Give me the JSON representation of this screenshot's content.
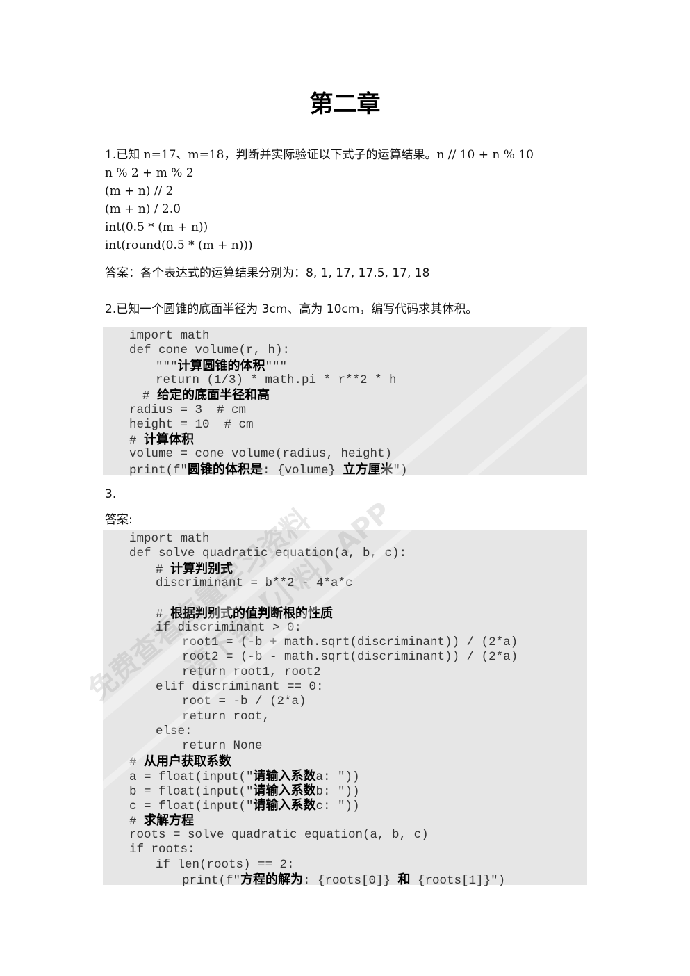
{
  "heading": "第二章",
  "q1": {
    "lines": [
      "1.已知 n=17、m=18，判断并实际验证以下式子的运算结果。n // 10 + n % 10",
      "n % 2 + m % 2",
      "(m + n) // 2",
      "(m + n) / 2.0",
      "int(0.5 * (m + n))",
      "int(round(0.5 * (m + n)))"
    ],
    "answer": "答案：各个表达式的运算结果分别为：8, 1, 17, 17.5, 17, 18"
  },
  "q2": {
    "question": "2.已知一个圆锥的底面半径为 3cm、高为 10cm，编写代码求其体积。",
    "code": [
      {
        "indent": 0,
        "parts": [
          {
            "t": "import math"
          }
        ]
      },
      {
        "indent": 0,
        "parts": [
          {
            "t": "def cone volume(r, h):"
          }
        ]
      },
      {
        "indent": 2,
        "parts": [
          {
            "t": "\"\"\""
          },
          {
            "t": "计算圆锥的体积",
            "cjk": true
          },
          {
            "t": "\"\"\""
          }
        ]
      },
      {
        "indent": 2,
        "parts": [
          {
            "t": "return (1/3) * math.pi * r**2 * h"
          }
        ]
      },
      {
        "indent": 1,
        "parts": [
          {
            "t": "# "
          },
          {
            "t": "给定的底面半径和高",
            "cjk": true
          }
        ]
      },
      {
        "indent": 0,
        "parts": [
          {
            "t": "radius = 3  # cm"
          }
        ]
      },
      {
        "indent": 0,
        "parts": [
          {
            "t": "height = 10  # cm"
          }
        ]
      },
      {
        "indent": 0,
        "parts": [
          {
            "t": "# "
          },
          {
            "t": "计算体积",
            "cjk": true
          }
        ]
      },
      {
        "indent": 0,
        "parts": [
          {
            "t": "volume = cone volume(radius, height)"
          }
        ]
      },
      {
        "indent": 0,
        "parts": [
          {
            "t": "print(f\""
          },
          {
            "t": "圆锥的体积是",
            "cjk": true
          },
          {
            "t": ": {volume} "
          },
          {
            "t": "立方厘米",
            "cjk": true
          },
          {
            "t": "\")"
          }
        ]
      }
    ]
  },
  "q3": {
    "number": "3.",
    "answer_label": "答案:",
    "code": [
      {
        "indent": 0,
        "parts": [
          {
            "t": "import math"
          }
        ]
      },
      {
        "indent": 0,
        "parts": [
          {
            "t": "def solve quadratic equation(a, b, c):"
          }
        ]
      },
      {
        "indent": 2,
        "parts": [
          {
            "t": "# "
          },
          {
            "t": "计算判别式",
            "cjk": true
          }
        ]
      },
      {
        "indent": 2,
        "parts": [
          {
            "t": "discriminant = b**2 - 4*a*c"
          }
        ]
      },
      {
        "indent": 0,
        "parts": [
          {
            "t": ""
          }
        ]
      },
      {
        "indent": 2,
        "parts": [
          {
            "t": "# "
          },
          {
            "t": "根据判别式的值判断根的性质",
            "cjk": true
          }
        ]
      },
      {
        "indent": 2,
        "parts": [
          {
            "t": "if discriminant > 0:"
          }
        ]
      },
      {
        "indent": 4,
        "parts": [
          {
            "t": "root1 = (-b + math.sqrt(discriminant)) / (2*a)"
          }
        ]
      },
      {
        "indent": 4,
        "parts": [
          {
            "t": "root2 = (-b - math.sqrt(discriminant)) / (2*a)"
          }
        ]
      },
      {
        "indent": 4,
        "parts": [
          {
            "t": "return root1, root2"
          }
        ]
      },
      {
        "indent": 2,
        "parts": [
          {
            "t": "elif discriminant == 0:"
          }
        ]
      },
      {
        "indent": 4,
        "parts": [
          {
            "t": "root = -b / (2*a)"
          }
        ]
      },
      {
        "indent": 4,
        "parts": [
          {
            "t": "return root,"
          }
        ]
      },
      {
        "indent": 2,
        "parts": [
          {
            "t": "else:"
          }
        ]
      },
      {
        "indent": 4,
        "parts": [
          {
            "t": "return None"
          }
        ]
      },
      {
        "indent": 0,
        "parts": [
          {
            "t": "# "
          },
          {
            "t": "从用户获取系数",
            "cjk": true
          }
        ]
      },
      {
        "indent": 0,
        "parts": [
          {
            "t": "a = float(input(\""
          },
          {
            "t": "请输入系数",
            "cjk": true
          },
          {
            "t": "a: \"))"
          }
        ]
      },
      {
        "indent": 0,
        "parts": [
          {
            "t": "b = float(input(\""
          },
          {
            "t": "请输入系数",
            "cjk": true
          },
          {
            "t": "b: \"))"
          }
        ]
      },
      {
        "indent": 0,
        "parts": [
          {
            "t": "c = float(input(\""
          },
          {
            "t": "请输入系数",
            "cjk": true
          },
          {
            "t": "c: \"))"
          }
        ]
      },
      {
        "indent": 0,
        "parts": [
          {
            "t": "# "
          },
          {
            "t": "求解方程",
            "cjk": true
          }
        ]
      },
      {
        "indent": 0,
        "parts": [
          {
            "t": "roots = solve quadratic equation(a, b, c)"
          }
        ]
      },
      {
        "indent": 0,
        "parts": [
          {
            "t": "if roots:"
          }
        ]
      },
      {
        "indent": 2,
        "parts": [
          {
            "t": "if len(roots) == 2:"
          }
        ]
      },
      {
        "indent": 4,
        "parts": [
          {
            "t": "print(f\""
          },
          {
            "t": "方程的解为",
            "cjk": true
          },
          {
            "t": ": {roots[0]} "
          },
          {
            "t": "和",
            "cjk": true
          },
          {
            "t": " {roots[1]}\")"
          }
        ]
      }
    ]
  },
  "watermark": {
    "line1": "免费查看海量学习资料",
    "line2": "请下载【小料】APP"
  }
}
